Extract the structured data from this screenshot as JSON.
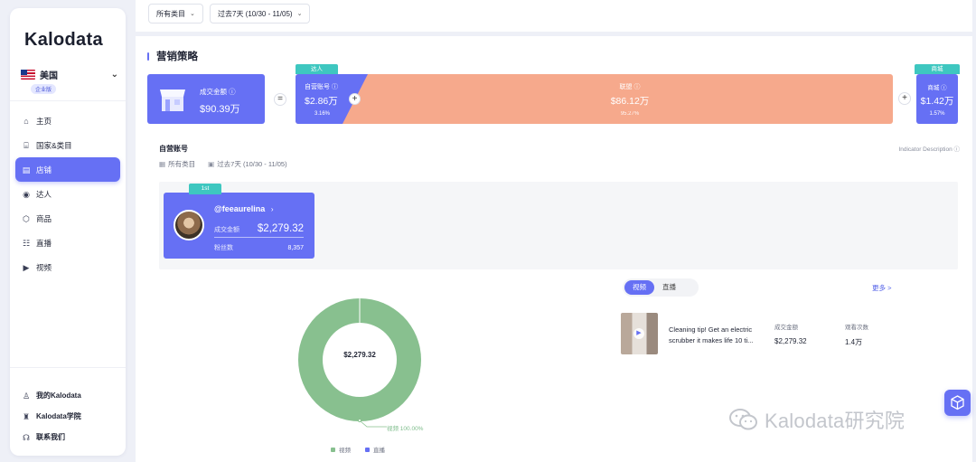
{
  "brand": {
    "logo_text": "Kalodata"
  },
  "sidebar": {
    "country": "美国",
    "plan_badge": "企业版",
    "items": [
      {
        "label": "主页",
        "icon": "home-icon"
      },
      {
        "label": "国家&类目",
        "icon": "bank-icon"
      },
      {
        "label": "店铺",
        "icon": "store-icon",
        "active": true
      },
      {
        "label": "达人",
        "icon": "location-pin-icon"
      },
      {
        "label": "商品",
        "icon": "box-icon"
      },
      {
        "label": "直播",
        "icon": "people-icon"
      },
      {
        "label": "视频",
        "icon": "video-icon"
      }
    ],
    "bottom_items": [
      {
        "label": "我的Kalodata",
        "icon": "user-icon"
      },
      {
        "label": "Kalodata学院",
        "icon": "graduation-icon"
      },
      {
        "label": "联系我们",
        "icon": "headset-icon"
      }
    ]
  },
  "filters": {
    "category": "所有类目",
    "date_range": "过去7天 (10/30 - 11/05)"
  },
  "section": {
    "title": "营销策略"
  },
  "gmv": {
    "label": "成交金额",
    "value": "$90.39万"
  },
  "operators": {
    "equals": "=",
    "plus": "+"
  },
  "mix": {
    "creator_tag": "达人",
    "own": {
      "label": "自营账号",
      "value": "$2.86万",
      "pct": "3.16%"
    },
    "affiliate": {
      "label": "联盟",
      "value": "$86.12万",
      "pct": "95.27%"
    }
  },
  "mall": {
    "tag": "商城",
    "label": "商城",
    "value": "$1.42万",
    "pct": "1.57%"
  },
  "own_accounts": {
    "title": "自营账号",
    "category": "所有类目",
    "date_range": "过去7天 (10/30 - 11/05)",
    "indicator_link": "Indicator Description",
    "account": {
      "rank": "1st",
      "handle": "@feeaurelina",
      "gmv_label": "成交金额",
      "gmv_value": "$2,279.32",
      "followers_label": "粉丝数",
      "followers_value": "8,357"
    }
  },
  "donut": {
    "center_value": "$2,279.32",
    "annotation": "视频 100.00%",
    "legend": [
      {
        "label": "视频",
        "color": "#88c08f"
      },
      {
        "label": "直播",
        "color": "#6670f4"
      }
    ]
  },
  "content_tabs": {
    "tabs": [
      "视频",
      "直播"
    ],
    "active": 0,
    "more": "更多 >"
  },
  "video": {
    "title": "Cleaning tip! Get an electric scrubber it makes life 10 ti...",
    "gmv_label": "成交金额",
    "gmv_value": "$2,279.32",
    "views_label": "观看次数",
    "views_value": "1.4万"
  },
  "watermark": "Kalodata研究院",
  "chart_data": {
    "type": "pie",
    "categories": [
      "视频",
      "直播"
    ],
    "values": [
      100.0,
      0.0
    ],
    "center_label": "$2,279.32",
    "legend_position": "bottom"
  }
}
